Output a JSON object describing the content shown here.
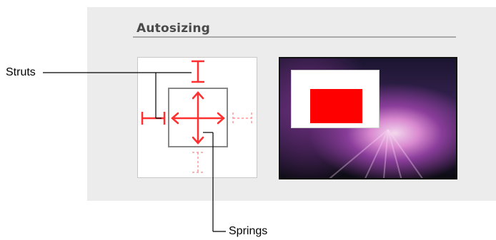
{
  "section": {
    "title": "Autosizing"
  },
  "callouts": {
    "struts": "Struts",
    "springs": "Springs"
  },
  "colors": {
    "panel_bg": "#ececec",
    "strut_red": "#ff3030",
    "inactive_strut": "#ff9999",
    "view_outline": "#888888",
    "preview_red_view": "#ff0000"
  },
  "icons": {
    "strut_markers": "i-beam",
    "springs": "double-headed-arrows",
    "preview": "desktop-wallpaper-preview"
  }
}
